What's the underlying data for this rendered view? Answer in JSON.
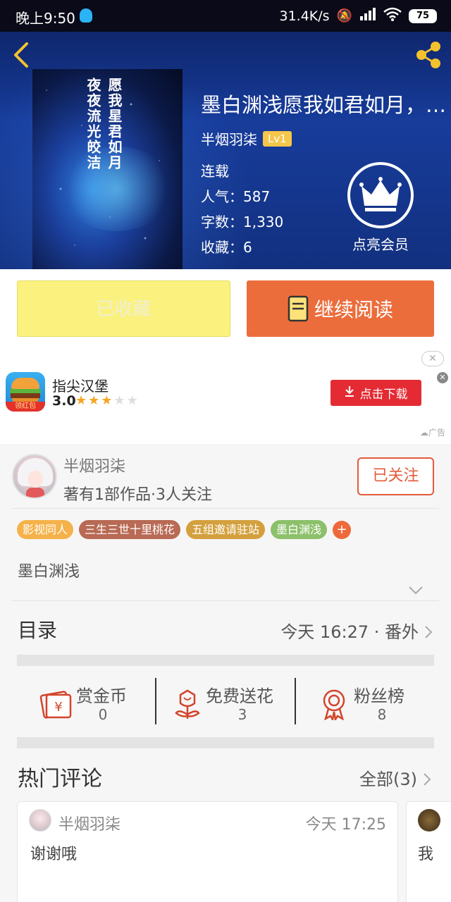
{
  "status_bar": {
    "time": "晚上9:50",
    "speed": "31.4K/s",
    "battery": "75"
  },
  "book": {
    "title": "墨白渊浅愿我如君如月，…",
    "author": "半烟羽柒",
    "level": "Lv1",
    "status": "连载",
    "popularity": "人气：587",
    "word_count": "字数：1,330",
    "favorites": "收藏：6",
    "cover_lines": [
      "愿我星君如月",
      "夜夜流光皎洁"
    ]
  },
  "vip": {
    "label": "点亮会员"
  },
  "actions": {
    "favorited_label": "已收藏",
    "continue_label": "继续阅读"
  },
  "ad": {
    "app_name": "指尖汉堡",
    "rating": "3.0",
    "stars_on": 3,
    "stars_total": 5,
    "badge": "领红包",
    "download_label": "点击下载",
    "ad_tag": "广告"
  },
  "author_info": {
    "name": "半烟羽柒",
    "stats": "著有1部作品·3人关注",
    "follow_label": "已关注"
  },
  "tags": [
    {
      "label": "影视同人",
      "color": "#f5b24a"
    },
    {
      "label": "三生三世十里桃花",
      "color": "#b86a55"
    },
    {
      "label": "五组邀请驻站",
      "color": "#d4a03e"
    },
    {
      "label": "墨白渊浅",
      "color": "#8cc06a"
    }
  ],
  "tag_add": "+",
  "description": "墨白渊浅",
  "toc": {
    "label": "目录",
    "latest": "今天 16:27 · 番外"
  },
  "stats": [
    {
      "label": "赏金币",
      "value": "0"
    },
    {
      "label": "免费送花",
      "value": "3"
    },
    {
      "label": "粉丝榜",
      "value": "8"
    }
  ],
  "comments": {
    "title": "热门评论",
    "all_label": "全部(3)",
    "items": [
      {
        "name": "半烟羽柒",
        "time": "今天 17:25",
        "text": "谢谢哦"
      },
      {
        "text": "我"
      }
    ]
  },
  "colors": {
    "accent_orange": "#ec6d3c",
    "fav_yellow": "#fbf17f",
    "ad_red": "#e42a32",
    "icon_red": "#d2452b"
  }
}
